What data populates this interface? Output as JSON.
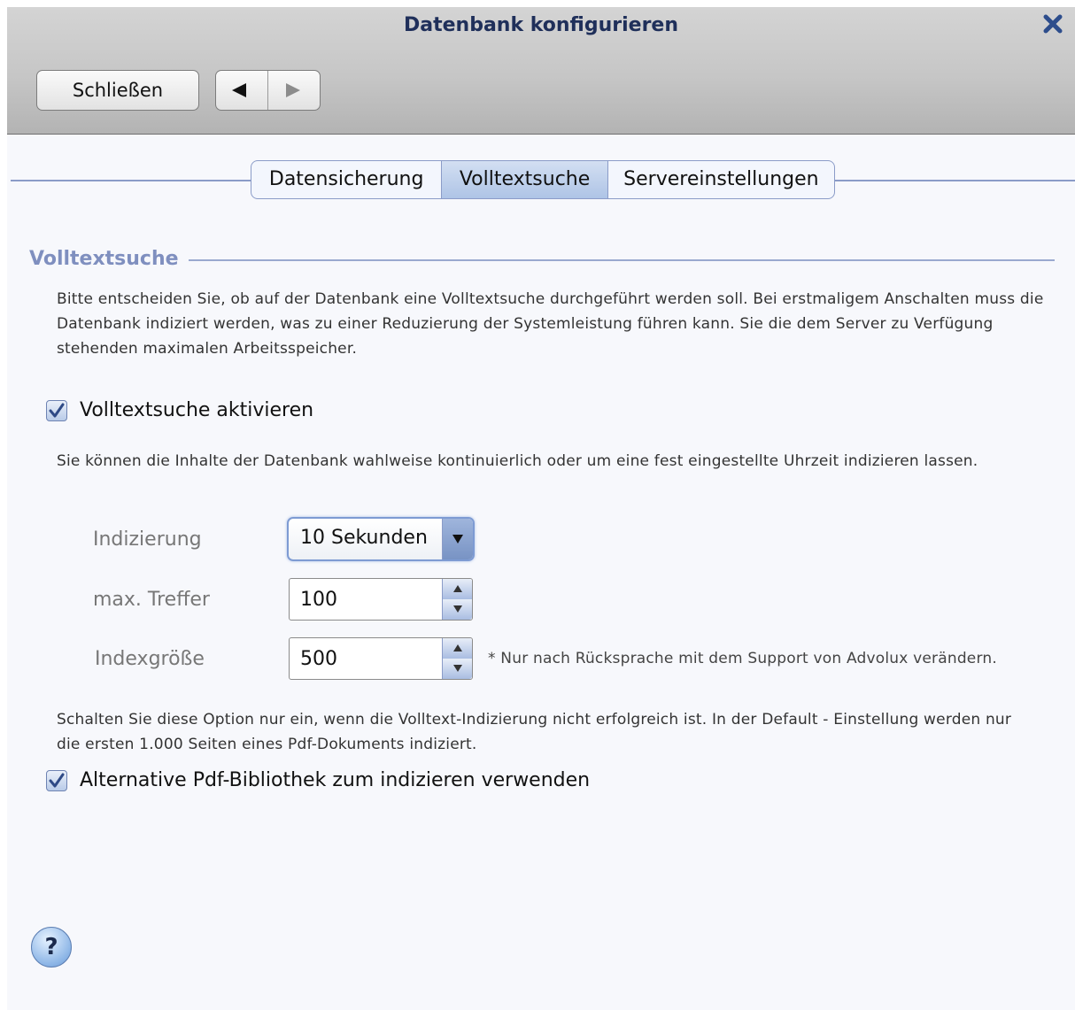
{
  "dialog": {
    "title": "Datenbank konfigurieren",
    "close_icon": "close-x-icon"
  },
  "toolbar": {
    "close_label": "Schließen",
    "prev_icon": "triangle-left-icon",
    "next_icon": "triangle-right-icon"
  },
  "tabs": [
    {
      "label": "Datensicherung",
      "selected": false
    },
    {
      "label": "Volltextsuche",
      "selected": true
    },
    {
      "label": "Servereinstellungen",
      "selected": false
    }
  ],
  "section": {
    "title": "Volltextsuche",
    "intro": "Bitte entscheiden Sie, ob auf der Datenbank eine Volltextsuche durchgeführt werden soll. Bei erstmaligem Anschalten muss die Datenbank indiziert werden, was zu einer Reduzierung der Systemleistung führen kann. Sie die dem Server zu Verfügung stehenden maximalen Arbeitsspeicher.",
    "enable_checkbox": {
      "label": "Volltextsuche aktivieren",
      "checked": true
    },
    "indexing_info": "Sie können die Inhalte der Datenbank wahlweise kontinuierlich oder um eine fest eingestellte Uhrzeit indizieren lassen.",
    "fields": {
      "indexing_label": "Indizierung",
      "indexing_value": "10 Sekunden",
      "max_hits_label": "max. Treffer",
      "max_hits_value": "100",
      "index_size_label": "Indexgröße",
      "index_size_value": "500",
      "index_size_note": "* Nur nach Rücksprache mit dem Support von Advolux verändern."
    },
    "pdf_info": "Schalten Sie diese Option nur ein, wenn die Volltext-Indizierung nicht erfolgreich ist. In der Default - Einstellung werden nur die ersten 1.000 Seiten eines Pdf-Dokuments indiziert.",
    "pdf_checkbox": {
      "label": "Alternative Pdf-Bibliothek zum indizieren verwenden",
      "checked": true
    }
  },
  "help": {
    "label": "?",
    "icon": "help-icon"
  },
  "colors": {
    "title": "#1f2f5a",
    "accent": "#7f8fbf",
    "close_icon": "#2d4d8c",
    "tab_selected": "#aec4e6",
    "checkmark": "#2f4a86"
  }
}
